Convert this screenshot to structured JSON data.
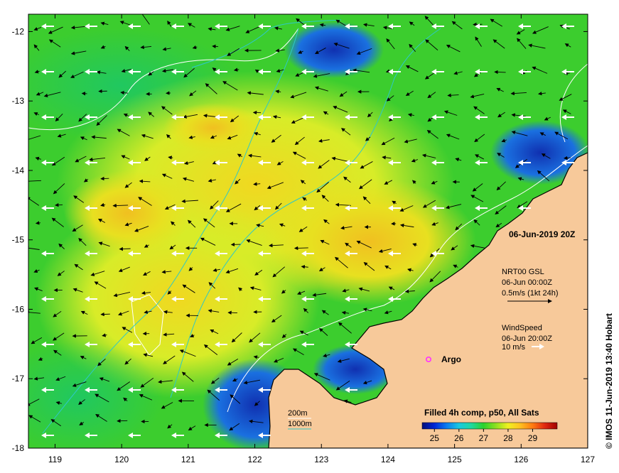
{
  "map": {
    "date_label": "06-Jun-2019 20Z",
    "lon_ticks": [
      "119",
      "120",
      "121",
      "122",
      "123",
      "124",
      "125",
      "126",
      "127"
    ],
    "lat_ticks": [
      "-12",
      "-13",
      "-14",
      "-15",
      "-16",
      "-17",
      "-18"
    ],
    "lon_range": [
      118.6,
      127.0
    ],
    "lat_range": [
      -18.0,
      -11.75
    ],
    "colors": {
      "land": "#f7c99a",
      "coast": "#000000",
      "isobath_200": "#ffffff",
      "isobath_1000": "#2ec8c8",
      "current_arrow": "#000000",
      "wind_arrow": "#ffffff",
      "argo": "#ff33ff"
    }
  },
  "currents": {
    "title": "NRT00 GSL",
    "time": "06-Jun 00:00Z",
    "scale": "0.5m/s (1kt 24h)"
  },
  "wind": {
    "title": "WindSpeed",
    "time": "06-Jun 20:00Z",
    "scale": "10 m/s"
  },
  "argo": {
    "label": "Argo",
    "lon": 124.6,
    "lat": -16.75
  },
  "isobaths": {
    "shallow": "200m",
    "deep": "1000m"
  },
  "colorbar": {
    "title": "Filled 4h comp, p50, All Sats",
    "ticks": [
      "25",
      "26",
      "27",
      "28",
      "29"
    ],
    "range": [
      24.5,
      30.0
    ],
    "stops": [
      "#000e7a",
      "#0026d6",
      "#0a7cf0",
      "#18c8e0",
      "#20d8a0",
      "#2cd22c",
      "#8ce020",
      "#f0f020",
      "#ffc020",
      "#ff7a10",
      "#e02810",
      "#a00000"
    ]
  },
  "credit": "© IMOS 11-Jun-2019 13:40 Hobart"
}
